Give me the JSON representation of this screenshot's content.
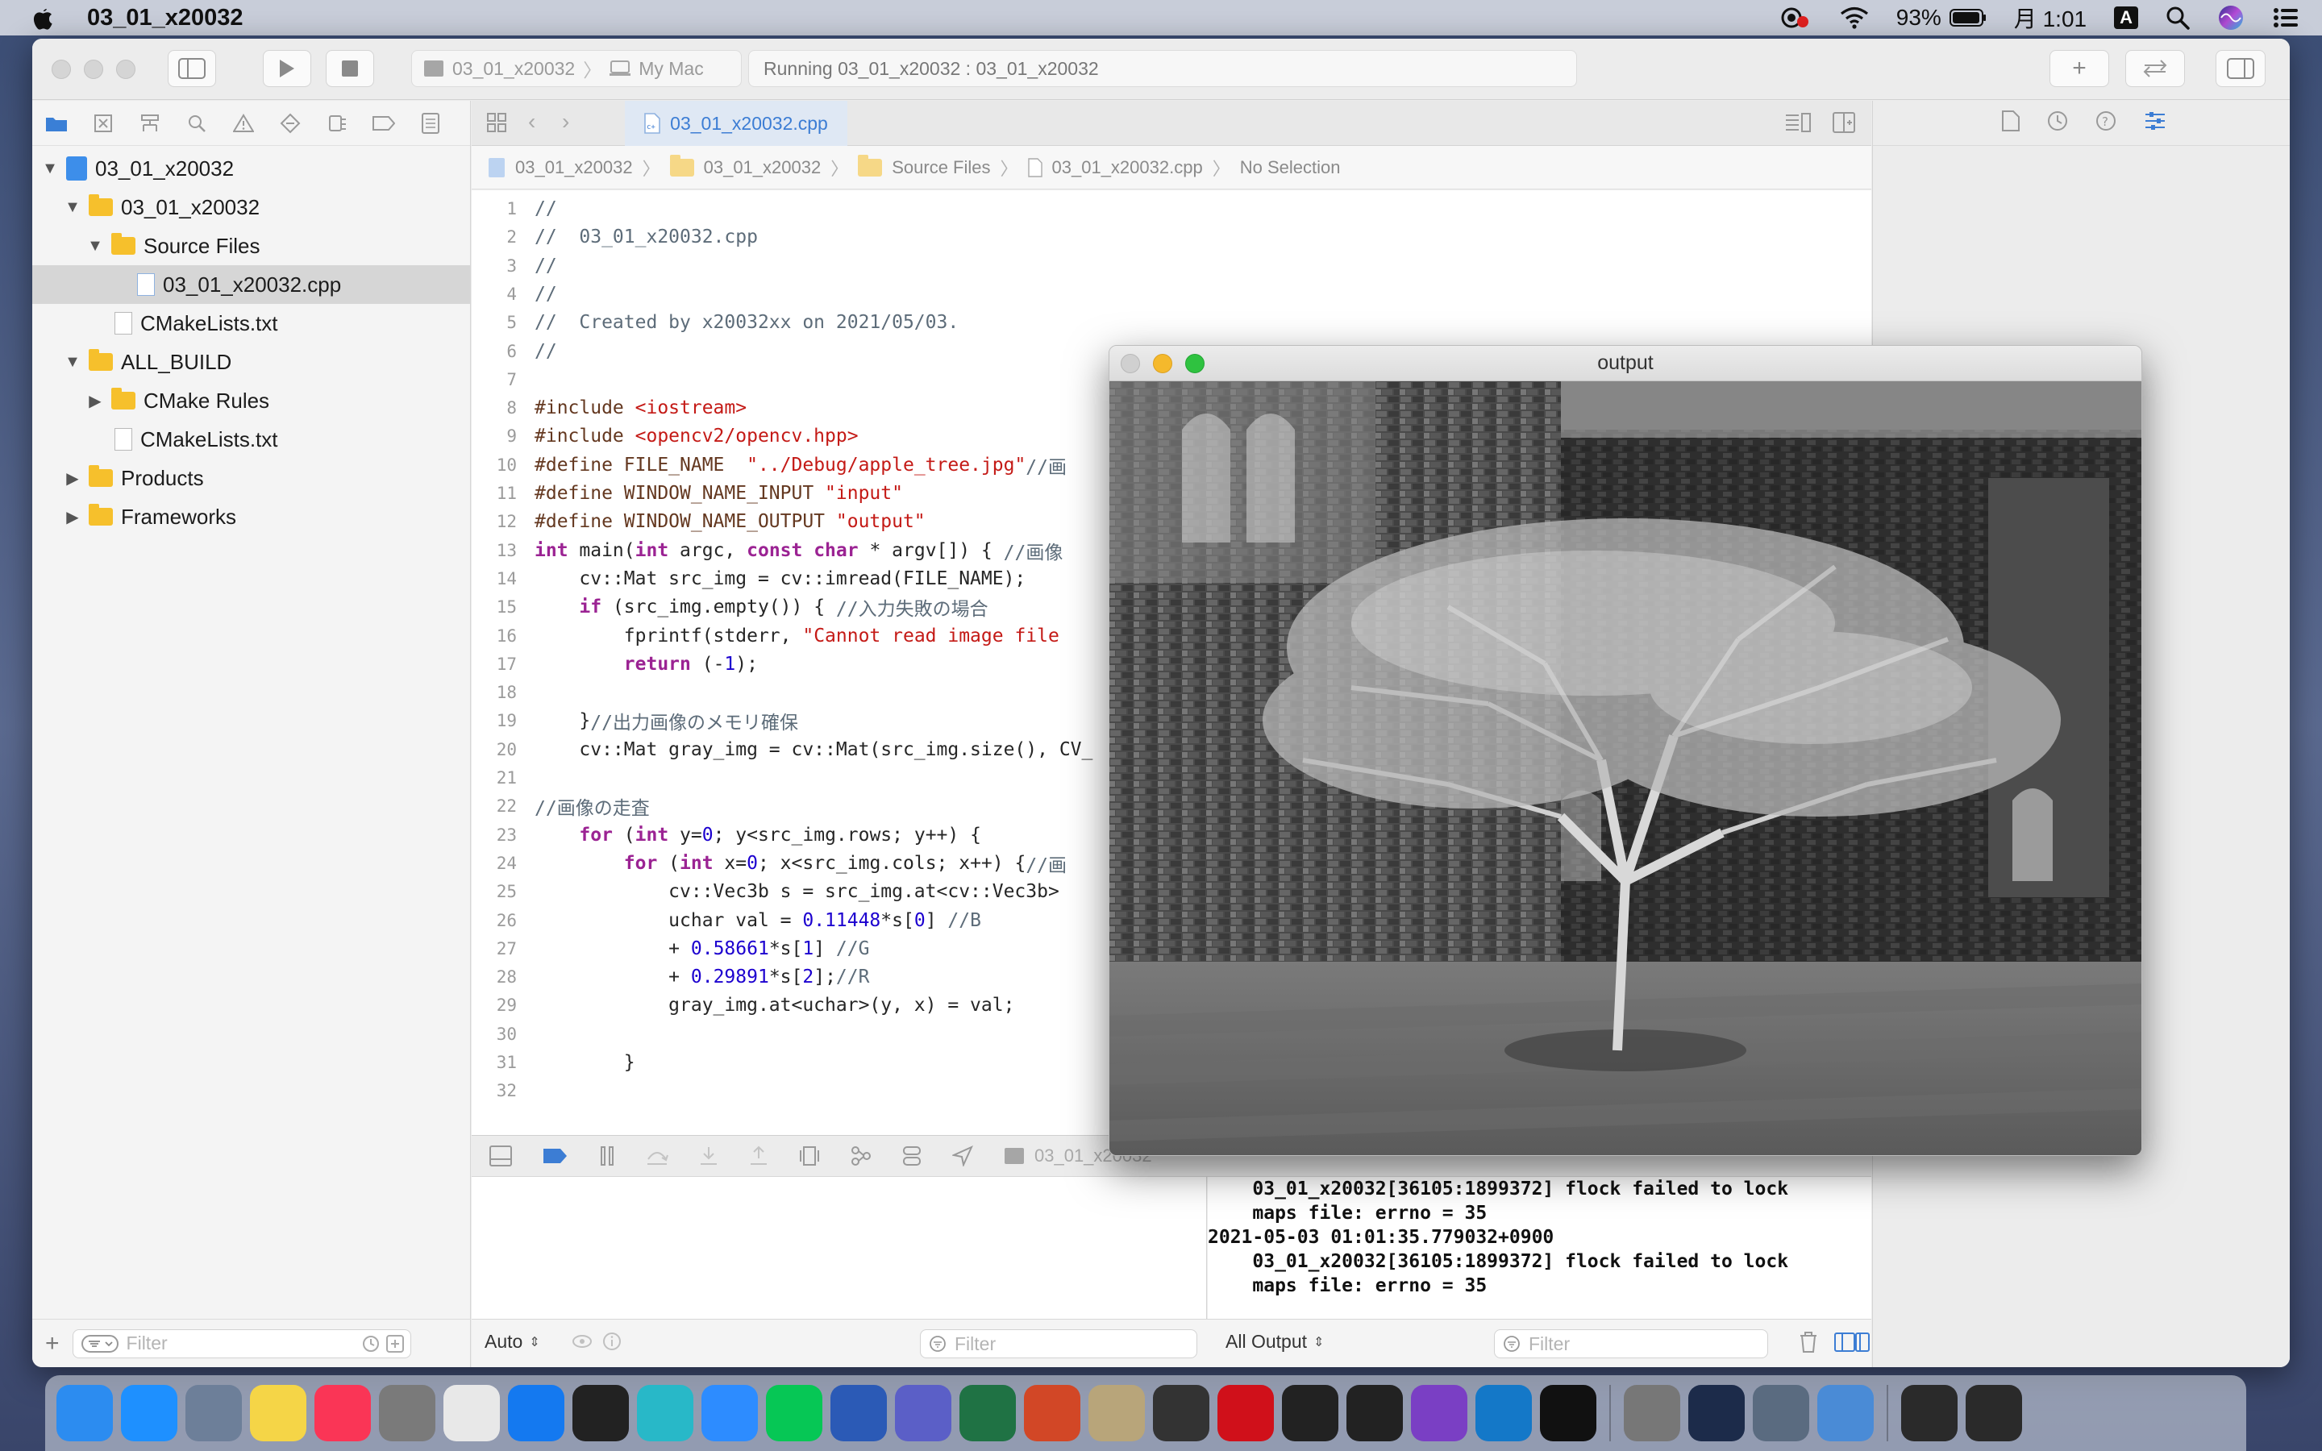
{
  "menubar": {
    "app_name": "03_01_x20032",
    "battery": "93%",
    "clock": "月 1:01",
    "input_method": "A"
  },
  "toolbar": {
    "scheme_target": "03_01_x20032",
    "scheme_device": "My Mac",
    "activity": "Running 03_01_x20032 : 03_01_x20032"
  },
  "navigator": {
    "items": [
      {
        "label": "03_01_x20032",
        "kind": "project",
        "indent": 0,
        "expanded": true
      },
      {
        "label": "03_01_x20032",
        "kind": "folder",
        "indent": 1,
        "expanded": true
      },
      {
        "label": "Source Files",
        "kind": "folder",
        "indent": 2,
        "expanded": true
      },
      {
        "label": "03_01_x20032.cpp",
        "kind": "cpp",
        "indent": 3,
        "selected": true
      },
      {
        "label": "CMakeLists.txt",
        "kind": "file",
        "indent": 2
      },
      {
        "label": "ALL_BUILD",
        "kind": "folder",
        "indent": 1,
        "expanded": true
      },
      {
        "label": "CMake Rules",
        "kind": "folder",
        "indent": 2,
        "expanded": false
      },
      {
        "label": "CMakeLists.txt",
        "kind": "file",
        "indent": 2
      },
      {
        "label": "Products",
        "kind": "folder",
        "indent": 1,
        "expanded": false
      },
      {
        "label": "Frameworks",
        "kind": "folder",
        "indent": 1,
        "expanded": false
      }
    ],
    "filter_placeholder": "Filter"
  },
  "editor": {
    "tab": "03_01_x20032.cpp",
    "jumpbar": [
      "03_01_x20032",
      "03_01_x20032",
      "Source Files",
      "03_01_x20032.cpp",
      "No Selection"
    ]
  },
  "code_lines": [
    {
      "n": "1",
      "tokens": [
        [
          "cm",
          "//"
        ]
      ]
    },
    {
      "n": "2",
      "tokens": [
        [
          "cm",
          "//  03_01_x20032.cpp"
        ]
      ]
    },
    {
      "n": "3",
      "tokens": [
        [
          "cm",
          "//"
        ]
      ]
    },
    {
      "n": "4",
      "tokens": [
        [
          "cm",
          "//"
        ]
      ]
    },
    {
      "n": "5",
      "tokens": [
        [
          "cm",
          "//  Created by x20032xx on 2021/05/03."
        ]
      ]
    },
    {
      "n": "6",
      "tokens": [
        [
          "cm",
          "//"
        ]
      ]
    },
    {
      "n": "7",
      "tokens": []
    },
    {
      "n": "8",
      "tokens": [
        [
          "pp",
          "#include "
        ],
        [
          "str",
          "<iostream>"
        ]
      ]
    },
    {
      "n": "9",
      "tokens": [
        [
          "pp",
          "#include "
        ],
        [
          "str",
          "<opencv2/opencv.hpp>"
        ]
      ]
    },
    {
      "n": "10",
      "tokens": [
        [
          "pp",
          "#define FILE_NAME  "
        ],
        [
          "str",
          "\"../Debug/apple_tree.jpg\""
        ],
        [
          "cm",
          "//画"
        ]
      ]
    },
    {
      "n": "11",
      "tokens": [
        [
          "pp",
          "#define WINDOW_NAME_INPUT "
        ],
        [
          "str",
          "\"input\""
        ]
      ]
    },
    {
      "n": "12",
      "tokens": [
        [
          "pp",
          "#define WINDOW_NAME_OUTPUT "
        ],
        [
          "str",
          "\"output\""
        ]
      ]
    },
    {
      "n": "13",
      "tokens": [
        [
          "kw",
          "int"
        ],
        [
          "ct",
          " main("
        ],
        [
          "kw",
          "int"
        ],
        [
          "ct",
          " argc, "
        ],
        [
          "kw",
          "const char"
        ],
        [
          "ct",
          " * argv[]) { "
        ],
        [
          "cm",
          "//画像"
        ]
      ]
    },
    {
      "n": "14",
      "tokens": [
        [
          "ct",
          "    cv::Mat src_img = cv::imread(FILE_NAME);"
        ]
      ]
    },
    {
      "n": "15",
      "tokens": [
        [
          "ct",
          "    "
        ],
        [
          "kw",
          "if"
        ],
        [
          "ct",
          " (src_img.empty()) { "
        ],
        [
          "cm",
          "//入力失敗の場合"
        ]
      ]
    },
    {
      "n": "16",
      "tokens": [
        [
          "ct",
          "        fprintf(stderr, "
        ],
        [
          "str",
          "\"Cannot read image file"
        ]
      ]
    },
    {
      "n": "17",
      "tokens": [
        [
          "ct",
          "        "
        ],
        [
          "kw",
          "return"
        ],
        [
          "ct",
          " (-"
        ],
        [
          "num",
          "1"
        ],
        [
          "ct",
          ");"
        ]
      ]
    },
    {
      "n": "18",
      "tokens": []
    },
    {
      "n": "19",
      "tokens": [
        [
          "ct",
          "    }"
        ],
        [
          "cm",
          "//出力画像のメモリ確保"
        ]
      ]
    },
    {
      "n": "20",
      "tokens": [
        [
          "ct",
          "    cv::Mat gray_img = cv::Mat(src_img.size(), CV_"
        ]
      ]
    },
    {
      "n": "21",
      "tokens": []
    },
    {
      "n": "22",
      "tokens": [
        [
          "cm",
          "//画像の走査"
        ]
      ]
    },
    {
      "n": "23",
      "tokens": [
        [
          "ct",
          "    "
        ],
        [
          "kw",
          "for"
        ],
        [
          "ct",
          " ("
        ],
        [
          "kw",
          "int"
        ],
        [
          "ct",
          " y="
        ],
        [
          "num",
          "0"
        ],
        [
          "ct",
          "; y<src_img.rows; y++) {"
        ]
      ]
    },
    {
      "n": "24",
      "tokens": [
        [
          "ct",
          "        "
        ],
        [
          "kw",
          "for"
        ],
        [
          "ct",
          " ("
        ],
        [
          "kw",
          "int"
        ],
        [
          "ct",
          " x="
        ],
        [
          "num",
          "0"
        ],
        [
          "ct",
          "; x<src_img.cols; x++) {"
        ],
        [
          "cm",
          "//画"
        ]
      ]
    },
    {
      "n": "25",
      "tokens": [
        [
          "ct",
          "            cv::Vec3b s = src_img.at<cv::Vec3b>"
        ]
      ]
    },
    {
      "n": "26",
      "tokens": [
        [
          "ct",
          "            uchar val = "
        ],
        [
          "num",
          "0.11448"
        ],
        [
          "ct",
          "*s["
        ],
        [
          "num",
          "0"
        ],
        [
          "ct",
          "] "
        ],
        [
          "cm",
          "//B"
        ]
      ]
    },
    {
      "n": "27",
      "tokens": [
        [
          "ct",
          "            + "
        ],
        [
          "num",
          "0.58661"
        ],
        [
          "ct",
          "*s["
        ],
        [
          "num",
          "1"
        ],
        [
          "ct",
          "] "
        ],
        [
          "cm",
          "//G"
        ]
      ]
    },
    {
      "n": "28",
      "tokens": [
        [
          "ct",
          "            + "
        ],
        [
          "num",
          "0.29891"
        ],
        [
          "ct",
          "*s["
        ],
        [
          "num",
          "2"
        ],
        [
          "ct",
          "];"
        ],
        [
          "cm",
          "//R"
        ]
      ]
    },
    {
      "n": "29",
      "tokens": [
        [
          "ct",
          "            gray_img.at<uchar>(y, x) = val;"
        ]
      ]
    },
    {
      "n": "30",
      "tokens": []
    },
    {
      "n": "31",
      "tokens": [
        [
          "ct",
          "        }"
        ]
      ]
    },
    {
      "n": "32",
      "tokens": []
    }
  ],
  "debug": {
    "process": "03_01_x20032",
    "variables_scope": "Auto",
    "filter_placeholder": "Filter",
    "console_scope": "All Output",
    "console_lines": [
      "    03_01_x20032[36105:1899372] flock failed to lock",
      "    maps file: errno = 35",
      "2021-05-03 01:01:35.779032+0900",
      "    03_01_x20032[36105:1899372] flock failed to lock",
      "    maps file: errno = 35"
    ]
  },
  "output_window": {
    "title": "output"
  },
  "dock": {
    "apps": [
      "Finder",
      "Safari",
      "Preview",
      "Notes",
      "Music",
      "System Preferences",
      "Chrome",
      "Xcode",
      "Terminal",
      "Maya",
      "Zoom",
      "LINE",
      "Word",
      "Teams",
      "Excel",
      "PowerPoint",
      "Script Editor",
      "Unity",
      "Acrobat",
      "Unity Hub",
      "Unity",
      "Visual Studio",
      "VS Code",
      "Epic Games",
      "Automator",
      "Instruments",
      "Utilities",
      "Preview",
      "exec",
      "exec"
    ]
  },
  "colors": {
    "accent": "#3c7dd4",
    "folder": "#f6c02c"
  }
}
